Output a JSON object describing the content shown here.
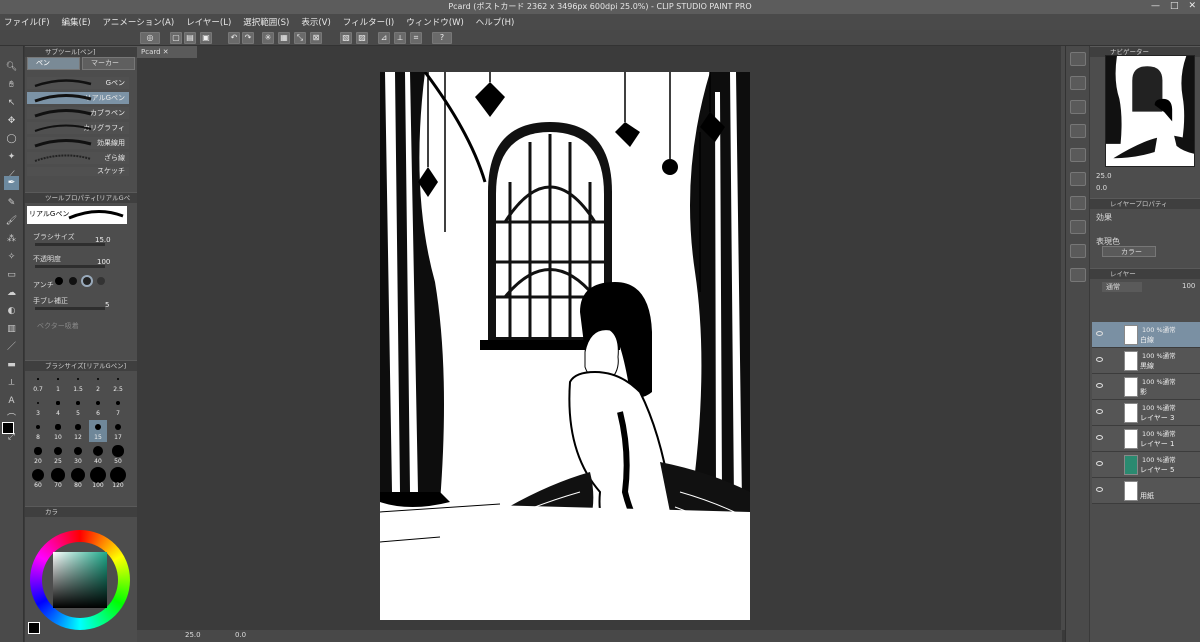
{
  "title": "Pcard (ポストカード 2362 x 3496px 600dpi 25.0%) - CLIP STUDIO PAINT PRO",
  "menu": [
    "ファイル(F)",
    "編集(E)",
    "アニメーション(A)",
    "レイヤー(L)",
    "選択範囲(S)",
    "表示(V)",
    "フィルター(I)",
    "ウィンドウ(W)",
    "ヘルプ(H)"
  ],
  "document_tab": "Pcard",
  "subtool_panel": {
    "header": "サブツール[ペン]",
    "tabs": [
      "ペン",
      "マーカー"
    ],
    "brushes": [
      "Gペン",
      "リアルGペン",
      "カブラペン",
      "カリグラフィ",
      "効果線用",
      "ざら線",
      "スケッチ"
    ],
    "selected_index": 1
  },
  "tool_property": {
    "header": "ツールプロパティ[リアルGペン]",
    "preview_label": "リアルGペン",
    "brush_size_label": "ブラシサイズ",
    "brush_size_value": "15.0",
    "opacity_label": "不透明度",
    "opacity_value": "100",
    "antialias_label": "アンチ",
    "stabilization_label": "手ブレ補正",
    "stabilization_value": "5",
    "vector_label": "ベクター吸着"
  },
  "brush_size_panel": {
    "header": "ブラシサイズ[リアルGペン]",
    "sizes": [
      "0.7",
      "1",
      "1.5",
      "2",
      "2.5",
      "3",
      "4",
      "5",
      "6",
      "7",
      "8",
      "10",
      "12",
      "15",
      "17",
      "20",
      "25",
      "30",
      "40",
      "50",
      "60",
      "70",
      "80",
      "100",
      "120"
    ],
    "selected": "15"
  },
  "color_panel": {
    "tab": "カラ",
    "main_color": "#1e9e86",
    "sub_color": "#ffffff"
  },
  "navigator": {
    "header": "ナビゲーター",
    "zoom": "25.0",
    "rotation": "0.0"
  },
  "layer_property": {
    "header": "レイヤープロパティ",
    "effect_label": "効果",
    "expression_label": "表現色",
    "expression_value": "カラー"
  },
  "layer_panel": {
    "header": "レイヤー",
    "blend_mode": "通常",
    "opacity": "100",
    "layers": [
      {
        "mode": "100 %通常",
        "name": "白線",
        "selected": true,
        "fill": "#ffffff"
      },
      {
        "mode": "100 %通常",
        "name": "黒線",
        "selected": false,
        "fill": "#ffffff"
      },
      {
        "mode": "100 %通常",
        "name": "影",
        "selected": false,
        "fill": "#ffffff"
      },
      {
        "mode": "100 %通常",
        "name": "レイヤー 3",
        "selected": false,
        "fill": "#ffffff"
      },
      {
        "mode": "100 %通常",
        "name": "レイヤー 1",
        "selected": false,
        "fill": "#ffffff"
      },
      {
        "mode": "100 %通常",
        "name": "レイヤー 5",
        "selected": false,
        "fill": "#2a8a70"
      },
      {
        "mode": "",
        "name": "用紙",
        "selected": false,
        "fill": "#ffffff"
      }
    ]
  },
  "status": {
    "zoom": "25.0",
    "rotation": "0.0"
  }
}
